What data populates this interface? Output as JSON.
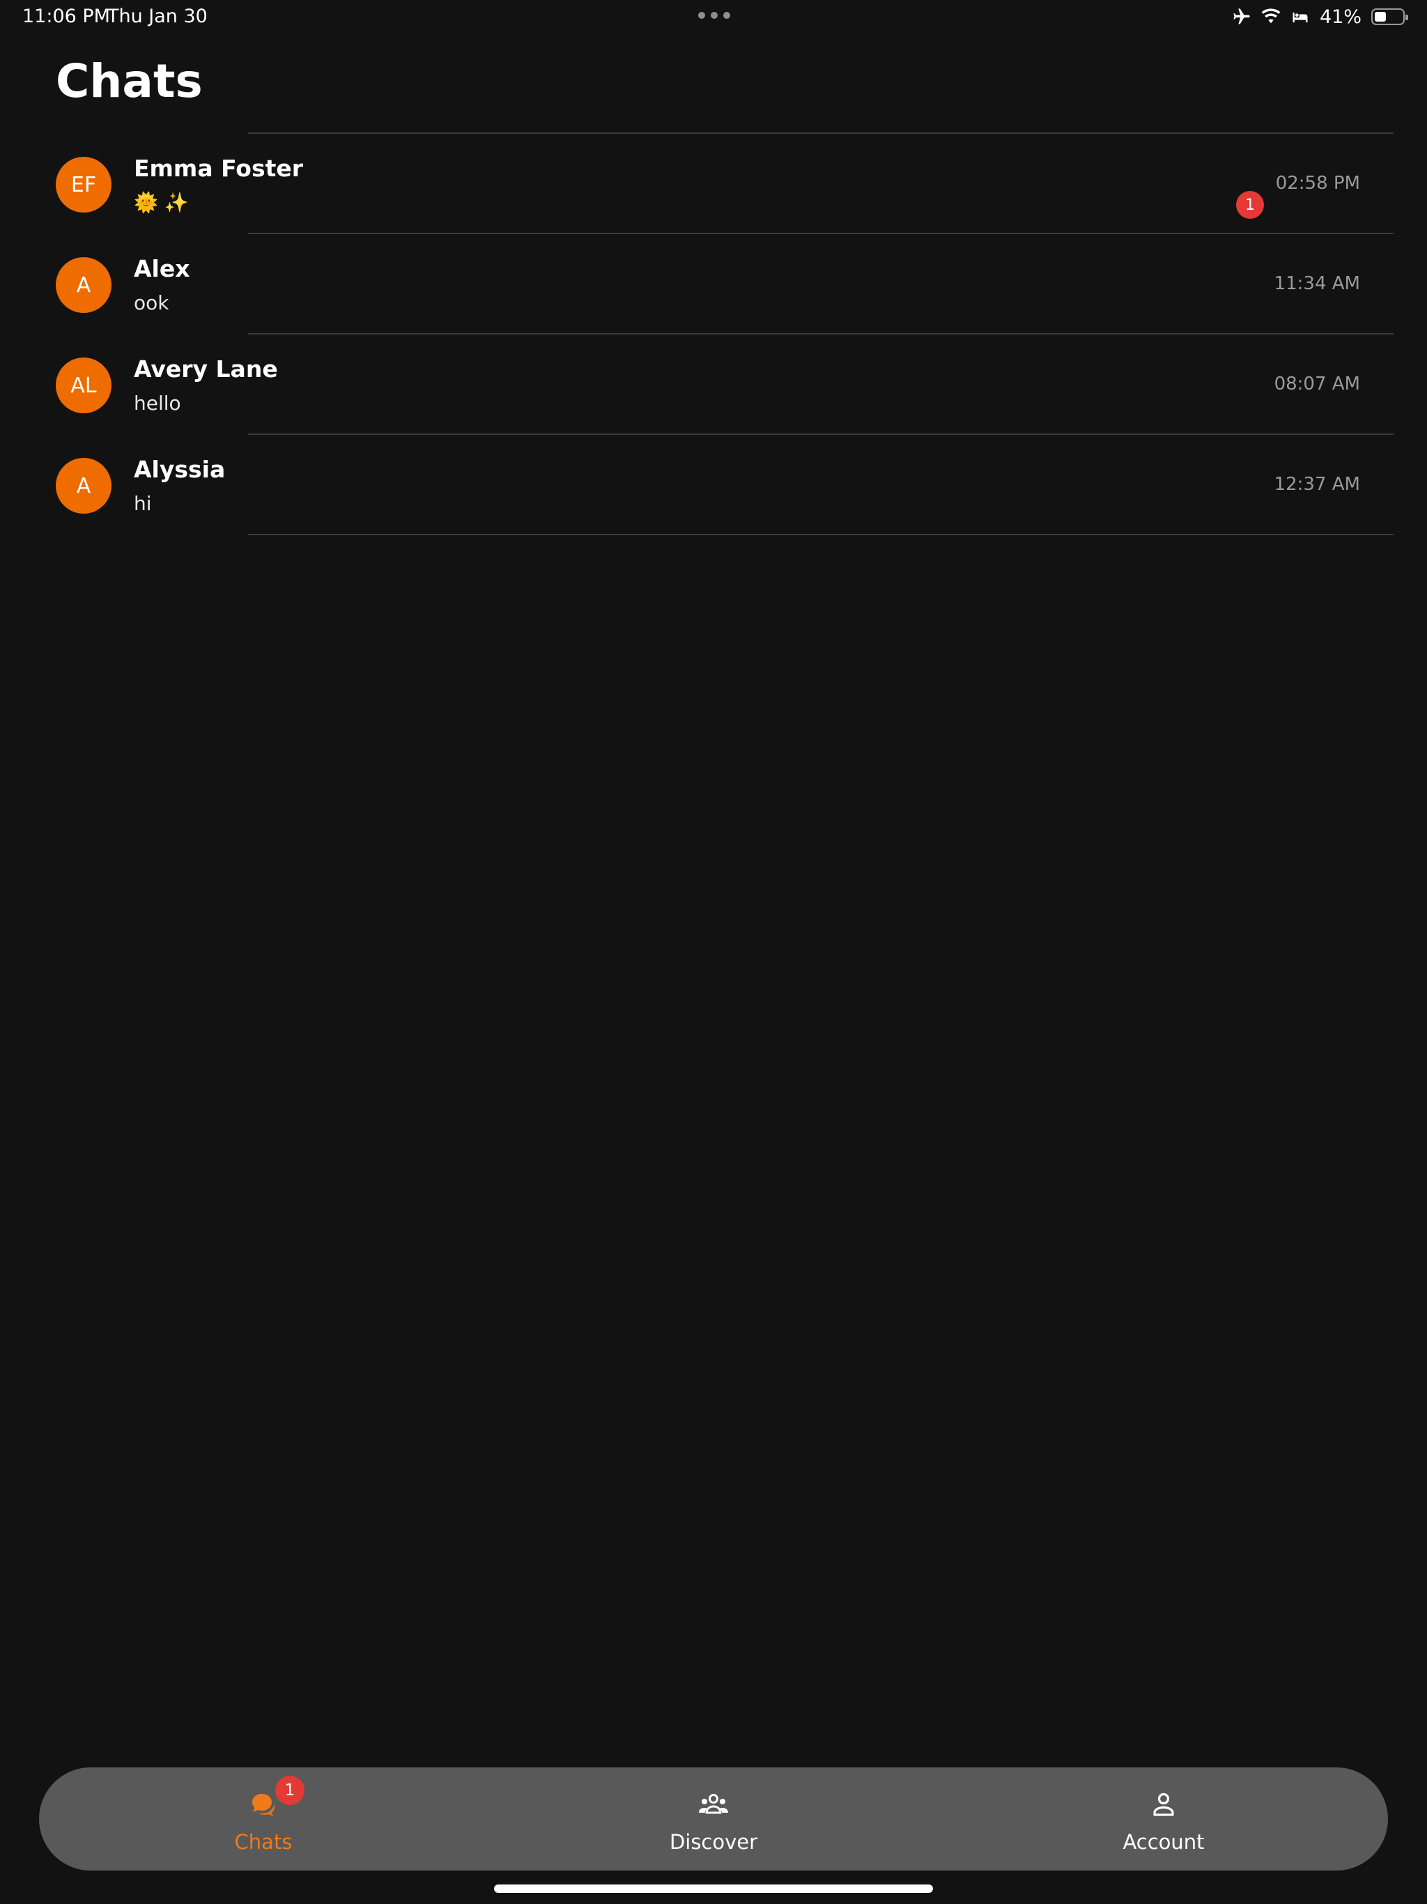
{
  "status_bar": {
    "time": "11:06 PM",
    "date": "Thu Jan 30",
    "battery_percent": "41%",
    "battery_level": 0.41
  },
  "header": {
    "title": "Chats"
  },
  "chats": [
    {
      "initials": "EF",
      "name": "Emma Foster",
      "preview": "🌞 ✨",
      "time": "02:58 PM",
      "unread": "1"
    },
    {
      "initials": "A",
      "name": "Alex",
      "preview": "ook",
      "time": "11:34 AM"
    },
    {
      "initials": "AL",
      "name": "Avery Lane",
      "preview": "hello",
      "time": "08:07 AM"
    },
    {
      "initials": "A",
      "name": "Alyssia",
      "preview": "hi",
      "time": "12:37 AM"
    }
  ],
  "tabs": [
    {
      "label": "Chats",
      "icon": "chat-bubbles-icon",
      "badge": "1",
      "active": true
    },
    {
      "label": "Discover",
      "icon": "group-icon",
      "active": false
    },
    {
      "label": "Account",
      "icon": "person-icon",
      "active": false
    }
  ],
  "colors": {
    "background": "#121212",
    "accent": "#ef6c00",
    "badge": "#e53935",
    "tab_bar": "#595959"
  }
}
